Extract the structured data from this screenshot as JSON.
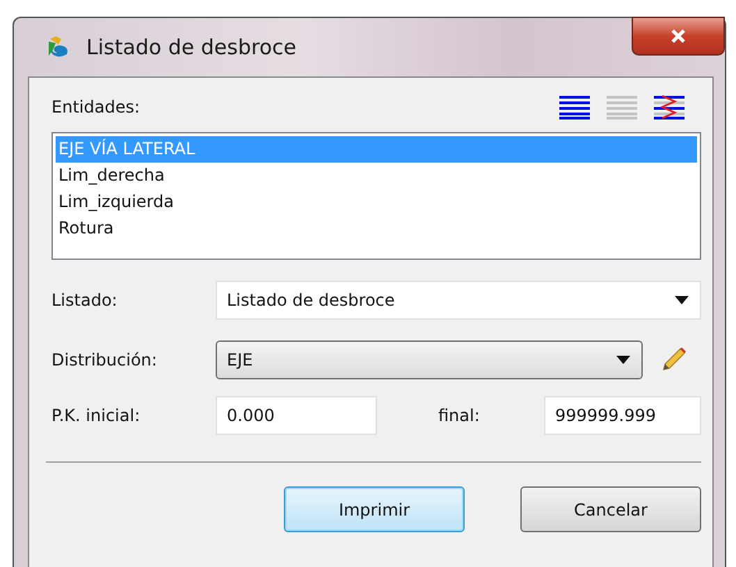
{
  "window": {
    "title": "Listado de desbroce"
  },
  "entities": {
    "label": "Entidades:",
    "items": [
      {
        "text": "EJE VÍA LATERAL",
        "selected": true
      },
      {
        "text": "Lim_derecha",
        "selected": false
      },
      {
        "text": "Lim_izquierda",
        "selected": false
      },
      {
        "text": "Rotura",
        "selected": false
      }
    ]
  },
  "listado": {
    "label": "Listado:",
    "value": "Listado de desbroce"
  },
  "distribucion": {
    "label": "Distribución:",
    "value": "EJE"
  },
  "pk": {
    "label": "P.K. inicial:",
    "initial": "0.000",
    "final_label": "final:",
    "final": "999999.999"
  },
  "buttons": [
    {
      "label": "Imprimir",
      "default": true
    },
    {
      "label": "Cancelar",
      "default": false
    }
  ]
}
